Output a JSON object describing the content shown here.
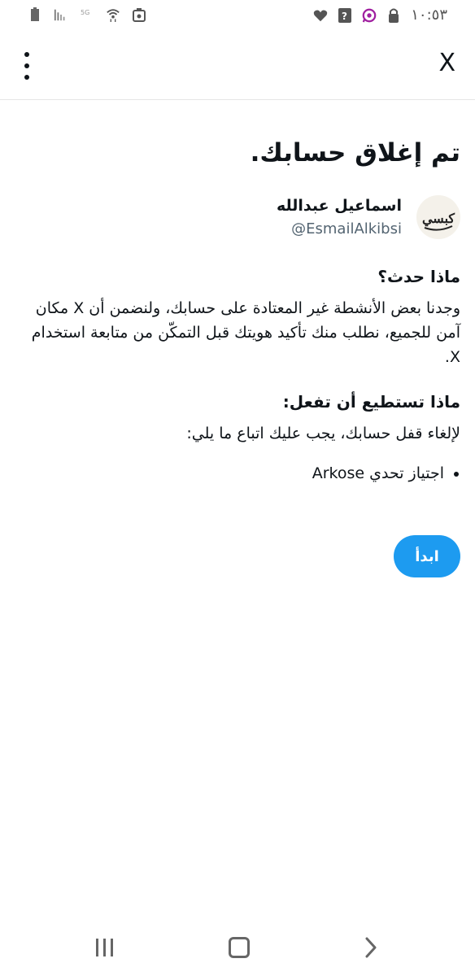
{
  "status_bar": {
    "time": "١٠:٥٣",
    "icons_left": [
      "battery-icon",
      "signal-icon",
      "data-5g-icon",
      "wifi-icon",
      "recycle-icon"
    ],
    "icons_right": [
      "heart-icon",
      "question-icon",
      "whatsapp-icon",
      "lock-icon"
    ]
  },
  "topbar": {
    "close_label": "X"
  },
  "main": {
    "title": "تم إغلاق حسابك.",
    "profile": {
      "name": "اسماعيل عبدالله",
      "handle": "@EsmailAlkibsi",
      "avatar_text": "كبسي"
    },
    "section1": {
      "heading": "ماذا حدث؟",
      "text": "وجدنا بعض الأنشطة غير المعتادة على حسابك، ولنضمن أن X مكان آمن للجميع، نطلب منك تأكيد هويتك قبل التمكّن من متابعة استخدام X."
    },
    "section2": {
      "heading": "ماذا تستطيع أن تفعل:",
      "text": "لإلغاء قفل حسابك، يجب عليك اتباع ما يلي:",
      "bullets": [
        "اجتياز تحدي Arkose"
      ]
    },
    "start_button": "ابدأ"
  },
  "colors": {
    "accent": "#1d9bf0",
    "text": "#0f1419",
    "secondary": "#536471"
  }
}
